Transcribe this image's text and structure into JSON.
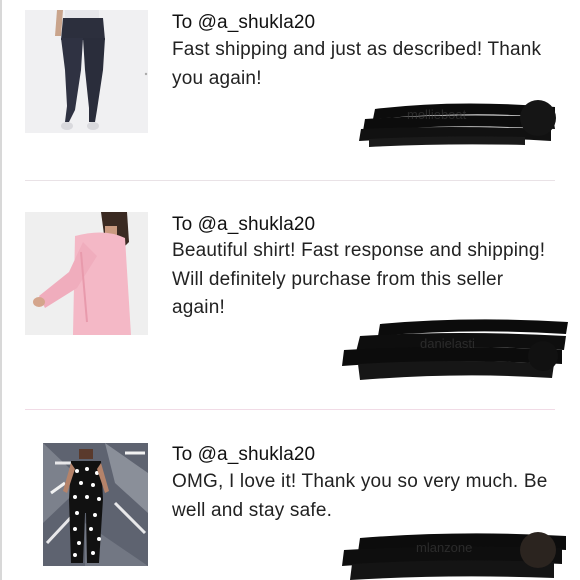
{
  "reviews": [
    {
      "to": "To @a_shukla20",
      "message": "Fast shipping and just as described! Thank you again!",
      "image": "dark-leggings-photo",
      "reviewer": "mollieboat",
      "redacted": true
    },
    {
      "to": "To @a_shukla20",
      "message": "Beautiful shirt! Fast response and shipping! Will definitely purchase from this seller again!",
      "image": "pink-long-sleeve-shirt-photo",
      "reviewer": "danielasti",
      "redacted": true
    },
    {
      "to": "To @a_shukla20",
      "message": "OMG, I love it! Thank you so very much. Be well and stay safe.",
      "image": "polka-dot-jumpsuit-photo",
      "reviewer": "mlanzone",
      "redacted": true
    }
  ],
  "colors": {
    "text": "#1a1a1a",
    "divider": "#e9e2e6",
    "redaction": "#0c0c0c"
  }
}
